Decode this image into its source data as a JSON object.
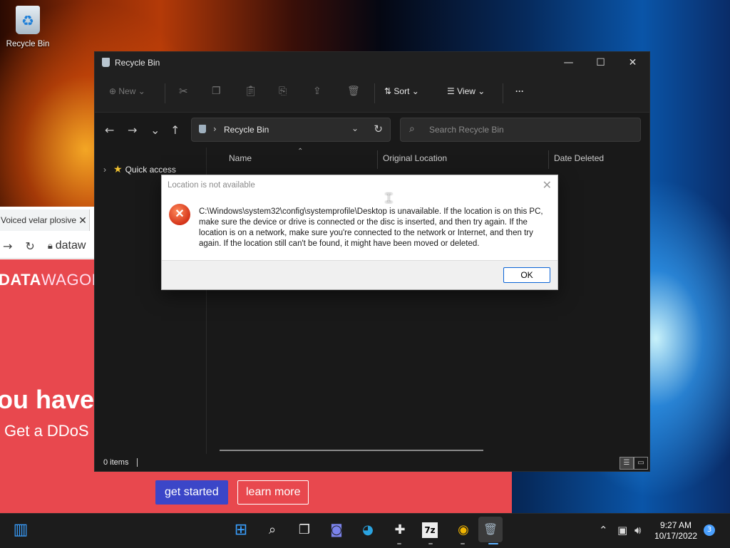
{
  "desktop": {
    "recycle_bin_label": "Recycle Bin"
  },
  "browser": {
    "tab_title": "Voiced velar plosive",
    "tab_close": "✕",
    "url": "dataw",
    "logo_bold": "DATA",
    "logo_light": "WAGON",
    "hero_text": "ou have",
    "hero_sub": "Get a DDoS",
    "btn_primary": "get started",
    "btn_secondary": "learn more"
  },
  "explorer": {
    "title": "Recycle Bin",
    "min": "—",
    "max": "☐",
    "close": "✕",
    "cmd": {
      "new": "New",
      "sort": "Sort",
      "view": "View",
      "more": "···"
    },
    "nav": {
      "back": "←",
      "forward": "→",
      "recent": "⌄",
      "up": "↑"
    },
    "address": "Recycle Bin",
    "search_placeholder": "Search Recycle Bin",
    "sidebar": {
      "quick_access": "Quick access"
    },
    "columns": [
      "Name",
      "Original Location",
      "Date Deleted"
    ],
    "status_count": "0 items"
  },
  "dialog": {
    "title": "Location is not available",
    "message": "C:\\Windows\\system32\\config\\systemprofile\\Desktop is unavailable. If the location is on this PC, make sure the device or drive is connected or the disc is inserted, and then try again. If the location is on a network, make sure you're connected to the network or Internet, and then try again. If the location still can't be found, it might have been moved or deleted.",
    "ok_label": "OK"
  },
  "taskbar": {
    "time": "9:27 AM",
    "date": "10/17/2022",
    "notification_count": "3",
    "sevenzip_label": "7z"
  },
  "colors": {
    "dialog_accent": "#0a64d6",
    "error_red": "#d4341a",
    "page_red": "#e8484e",
    "button_blue": "#3b46c8"
  }
}
